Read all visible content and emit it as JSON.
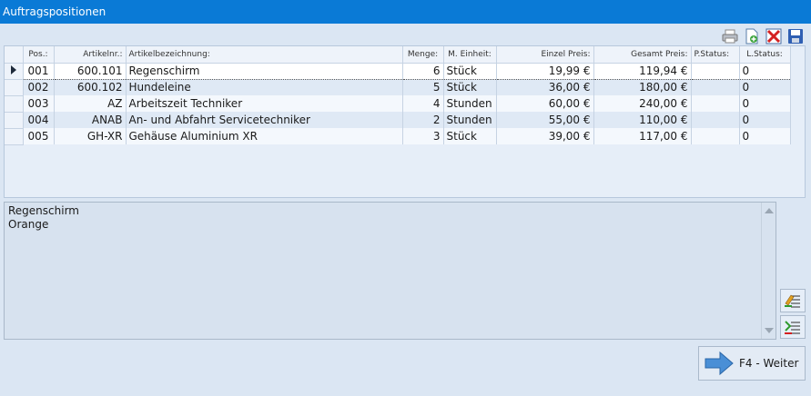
{
  "window": {
    "title": "Auftragspositionen"
  },
  "toolbar": {
    "icons": [
      "printer-icon",
      "new-document-icon",
      "delete-icon",
      "save-icon"
    ]
  },
  "grid": {
    "columns": [
      "Pos.:",
      "Artikelnr.:",
      "Artikelbezeichnung:",
      "Menge:",
      "M. Einheit:",
      "Einzel Preis:",
      "Gesamt Preis:",
      "P.Status:",
      "L.Status:"
    ],
    "rows": [
      {
        "pos": "001",
        "artikelnr": "600.101",
        "bezeichnung": "Regenschirm",
        "menge": "6",
        "einheit": "Stück",
        "einzel": "19,99 €",
        "gesamt": "119,94 €",
        "pstatus": "",
        "lstatus": "0"
      },
      {
        "pos": "002",
        "artikelnr": "600.102",
        "bezeichnung": "Hundeleine",
        "menge": "5",
        "einheit": "Stück",
        "einzel": "36,00 €",
        "gesamt": "180,00 €",
        "pstatus": "",
        "lstatus": "0"
      },
      {
        "pos": "003",
        "artikelnr": "AZ",
        "bezeichnung": "Arbeitszeit Techniker",
        "menge": "4",
        "einheit": "Stunden",
        "einzel": "60,00 €",
        "gesamt": "240,00 €",
        "pstatus": "",
        "lstatus": "0"
      },
      {
        "pos": "004",
        "artikelnr": "ANAB",
        "bezeichnung": "An- und Abfahrt Servicetechniker",
        "menge": "2",
        "einheit": "Stunden",
        "einzel": "55,00 €",
        "gesamt": "110,00 €",
        "pstatus": "",
        "lstatus": "0"
      },
      {
        "pos": "005",
        "artikelnr": "GH-XR",
        "bezeichnung": "Gehäuse Aluminium XR",
        "menge": "3",
        "einheit": "Stück",
        "einzel": "39,00 €",
        "gesamt": "117,00 €",
        "pstatus": "",
        "lstatus": "0"
      }
    ]
  },
  "memo": {
    "text": "Regenschirm\nOrange"
  },
  "buttons": {
    "weiter": "F4 - Weiter"
  }
}
